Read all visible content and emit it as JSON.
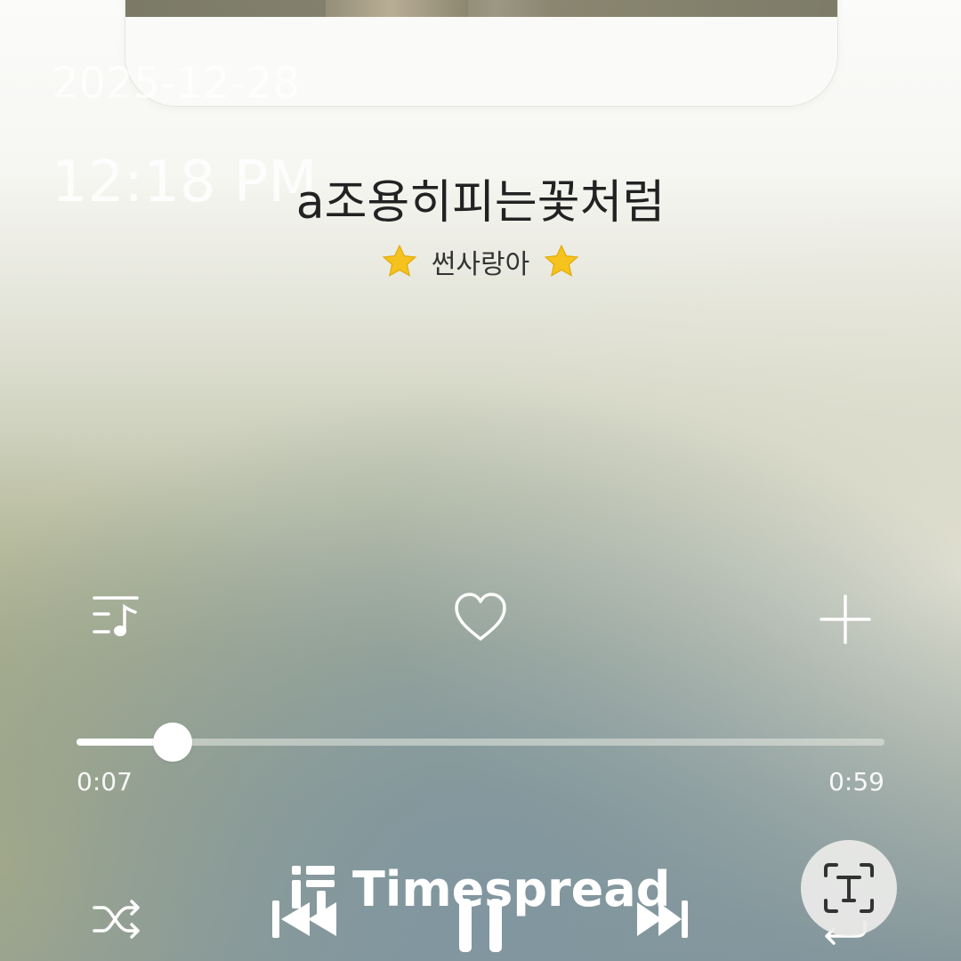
{
  "overlay": {
    "date": "2025-12-28",
    "time": "12:18 PM"
  },
  "song": {
    "title": "a조용히피는꽃처럼",
    "artist": "썬사랑아"
  },
  "icons": {
    "playlist": "playlist-music-icon",
    "like": "heart-outline-icon",
    "add": "plus-icon",
    "shuffle": "shuffle-icon",
    "previous": "skip-previous-icon",
    "play_pause": "pause-icon",
    "next": "skip-next-icon",
    "repeat": "repeat-icon",
    "text_scan": "text-recognition-icon"
  },
  "progress": {
    "current": "0:07",
    "total": "0:59",
    "fraction": 0.1187
  },
  "watermark": {
    "text": "Timespread"
  },
  "colors": {
    "title": "#222222",
    "icon": "#ffffff",
    "star": "#f6c21d"
  }
}
